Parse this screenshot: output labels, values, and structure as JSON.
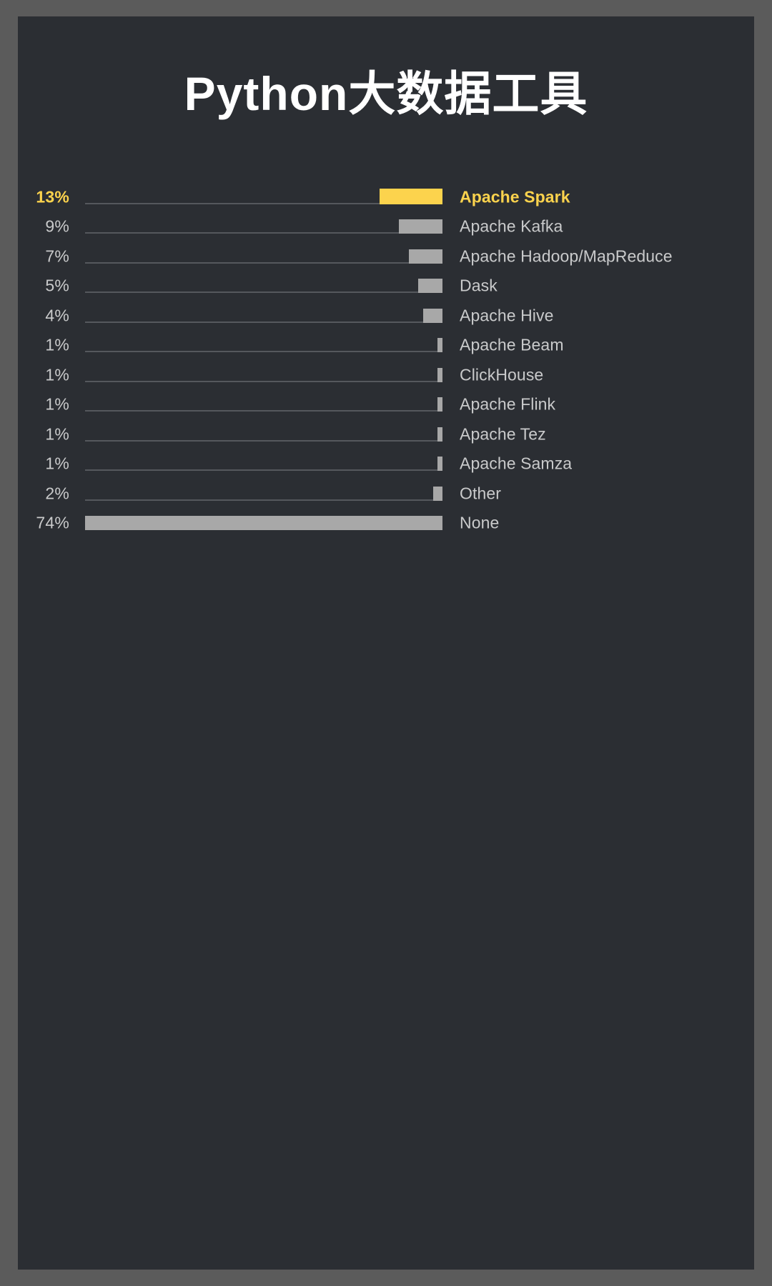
{
  "colors": {
    "page_background": "#5b5b5b",
    "card_background": "#2b2e33",
    "title": "#ffffff",
    "bar_default": "#a8a8a8",
    "bar_highlight": "#fcd34d",
    "text_default": "#c9cacb",
    "text_highlight": "#fcd34d",
    "track": "#55585d"
  },
  "chart_data": {
    "type": "bar",
    "title": "Python大数据工具",
    "xlabel": "",
    "ylabel": "",
    "orientation": "horizontal",
    "value_suffix": "%",
    "axis_max": 74,
    "grid": false,
    "legend": "none",
    "highlight_index": 0,
    "categories": [
      "Apache Spark",
      "Apache Kafka",
      "Apache Hadoop/MapReduce",
      "Dask",
      "Apache Hive",
      "Apache Beam",
      "ClickHouse",
      "Apache Flink",
      "Apache Tez",
      "Apache Samza",
      "Other",
      "None"
    ],
    "values": [
      13,
      9,
      7,
      5,
      4,
      1,
      1,
      1,
      1,
      1,
      2,
      74
    ],
    "value_labels": [
      "13%",
      "9%",
      "7%",
      "5%",
      "4%",
      "1%",
      "1%",
      "1%",
      "1%",
      "1%",
      "2%",
      "74%"
    ]
  },
  "rows": [
    {
      "pct": "13%",
      "label": "Apache Spark",
      "value": 13,
      "highlight": true
    },
    {
      "pct": "9%",
      "label": "Apache Kafka",
      "value": 9,
      "highlight": false
    },
    {
      "pct": "7%",
      "label": "Apache Hadoop/MapReduce",
      "value": 7,
      "highlight": false
    },
    {
      "pct": "5%",
      "label": "Dask",
      "value": 5,
      "highlight": false
    },
    {
      "pct": "4%",
      "label": "Apache Hive",
      "value": 4,
      "highlight": false
    },
    {
      "pct": "1%",
      "label": "Apache Beam",
      "value": 1,
      "highlight": false
    },
    {
      "pct": "1%",
      "label": "ClickHouse",
      "value": 1,
      "highlight": false
    },
    {
      "pct": "1%",
      "label": "Apache Flink",
      "value": 1,
      "highlight": false
    },
    {
      "pct": "1%",
      "label": "Apache Tez",
      "value": 1,
      "highlight": false
    },
    {
      "pct": "1%",
      "label": "Apache Samza",
      "value": 1,
      "highlight": false
    },
    {
      "pct": "2%",
      "label": "Other",
      "value": 2,
      "highlight": false
    },
    {
      "pct": "74%",
      "label": "None",
      "value": 74,
      "highlight": false
    }
  ]
}
